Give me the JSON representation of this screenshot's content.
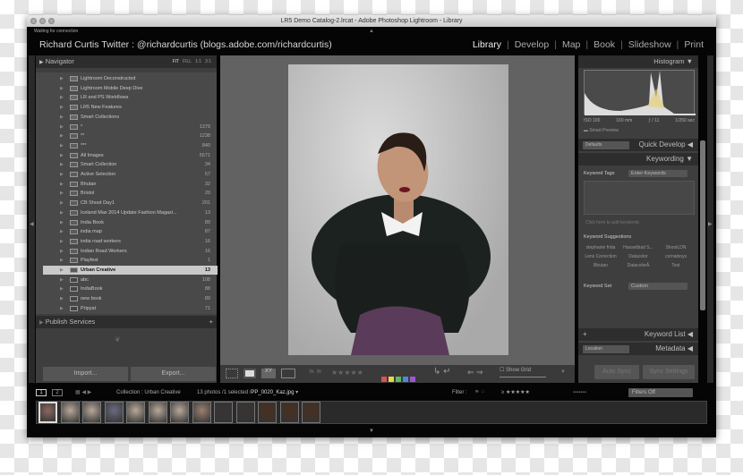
{
  "window": {
    "title": "LR5 Demo Catalog-2.lrcat - Adobe Photoshop Lightroom - Library",
    "status": "Waiting for connection"
  },
  "identity_plate": "Richard Curtis Twitter : @richardcurtis (blogs.adobe.com/richardcurtis)",
  "modules": [
    {
      "label": "Library",
      "active": true
    },
    {
      "label": "Develop"
    },
    {
      "label": "Map"
    },
    {
      "label": "Book"
    },
    {
      "label": "Slideshow"
    },
    {
      "label": "Print"
    }
  ],
  "navigator": {
    "title": "Navigator",
    "zoom_options": [
      "FIT",
      "FILL",
      "1:1",
      "3:1"
    ]
  },
  "collections": [
    {
      "label": "Lightroom Deconstructed",
      "type": "set"
    },
    {
      "label": "Lightroom Mobile Deep Dive",
      "type": "set"
    },
    {
      "label": "LR and PS Workflows",
      "type": "set"
    },
    {
      "label": "LR5 New Features",
      "type": "set"
    },
    {
      "label": "Smart Collections",
      "type": "set"
    },
    {
      "label": "*",
      "count": "1379",
      "type": "smart"
    },
    {
      "label": "**",
      "count": "1238",
      "type": "smart"
    },
    {
      "label": "***",
      "count": "840",
      "type": "smart"
    },
    {
      "label": "All Images",
      "count": "5571",
      "type": "smart"
    },
    {
      "label": "Smart Collection",
      "count": "34",
      "type": "smart"
    },
    {
      "label": "Active Selection",
      "count": "57",
      "type": "collection"
    },
    {
      "label": "Bhutan",
      "count": "32",
      "type": "collection"
    },
    {
      "label": "Bristol",
      "count": "20",
      "type": "collection"
    },
    {
      "label": "CB Shoot Day1",
      "count": "201",
      "type": "collection"
    },
    {
      "label": "Iceland Max 2014 Update Fashion Magazi...",
      "count": "13",
      "type": "collection"
    },
    {
      "label": "India Book",
      "count": "89",
      "type": "collection"
    },
    {
      "label": "india map",
      "count": "87",
      "type": "collection"
    },
    {
      "label": "india road workers",
      "count": "16",
      "type": "collection"
    },
    {
      "label": "Indian Road Workers",
      "count": "16",
      "type": "collection"
    },
    {
      "label": "Playfest",
      "count": "1",
      "type": "collection"
    },
    {
      "label": "Urban Creative",
      "count": "13",
      "type": "collection",
      "selected": true
    },
    {
      "label": "abc",
      "count": "108",
      "type": "book"
    },
    {
      "label": "IndiaBook",
      "count": "88",
      "type": "book"
    },
    {
      "label": "new book",
      "count": "89",
      "type": "book"
    },
    {
      "label": "Pripyat",
      "count": "71",
      "type": "slideshow"
    }
  ],
  "publish_services": {
    "title": "Publish Services",
    "add": "+"
  },
  "import_label": "Import...",
  "export_label": "Export...",
  "histogram": {
    "title": "Histogram",
    "iso": "ISO 100",
    "focal": "100 mm",
    "aperture": "ƒ / 11",
    "shutter": "1/250 sec",
    "smart_preview": "Smart Preview"
  },
  "quick_develop": {
    "title": "Quick Develop",
    "preset": "Defaults"
  },
  "keywording": {
    "title": "Keywording",
    "tags_label": "Keyword Tags",
    "tags_value": "Enter Keywords",
    "add_placeholder": "Click here to add keywords",
    "suggestions_title": "Keyword Suggestions",
    "suggestions": [
      "stephanie frida",
      "Hasselblad S...",
      "ShootLDN",
      "Lens Correction",
      "Datacolor",
      "cornwboys",
      "Bhutan",
      "DatacolorÂ",
      "Test"
    ],
    "set_label": "Keyword Set",
    "set_value": "Custom"
  },
  "keyword_list": {
    "title": "Keyword List",
    "add": "+"
  },
  "metadata": {
    "title": "Metadata",
    "preset": "Location"
  },
  "sync": {
    "auto": "Auto Sync",
    "settings": "Sync Settings"
  },
  "toolbar": {
    "show_grid": "Show Grid",
    "label_colors": [
      "#d9534f",
      "#e5d84a",
      "#5cb85c",
      "#4a8ad9",
      "#9b59d0"
    ]
  },
  "filmstrip": {
    "screen1": "1",
    "screen2": "2",
    "source": "Collection : Urban Creative",
    "count": "13 photos /1 selected /",
    "file": "PP_0020_Kaz.jpg",
    "filter_label": "Filter :",
    "filter_preset": "Filters Off",
    "thumbnails": 13
  }
}
